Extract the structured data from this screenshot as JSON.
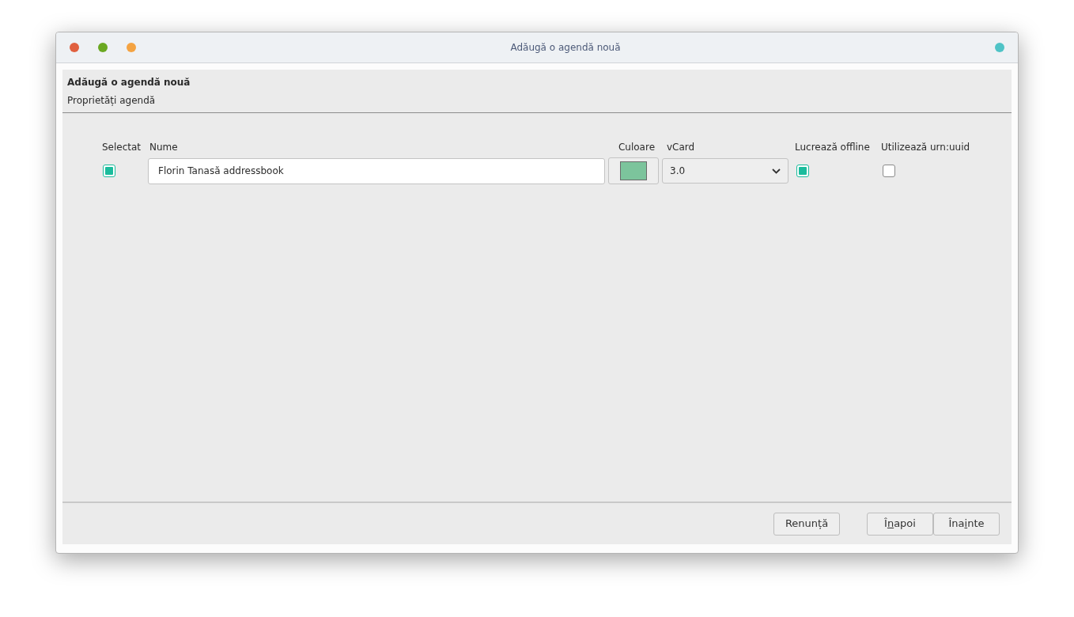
{
  "window": {
    "title": "Adăugă o agendă nouă"
  },
  "header": {
    "title": "Adăugă o agendă nouă",
    "subtitle": "Proprietăți agendă"
  },
  "columns": [
    "Selectat",
    "Nume",
    "Culoare",
    "vCard",
    "Lucrează offline",
    "Utilizează urn:uuid"
  ],
  "row": {
    "selected": true,
    "name": "Florin Tanasă addressbook",
    "color": "#7cc49c",
    "vcard": "3.0",
    "offline": true,
    "urn_uuid": false
  },
  "buttons": [
    {
      "kind": "cancel",
      "before": "Renunță"
    },
    {
      "kind": "back",
      "before": "Î",
      "key": "n",
      "after": "apoi"
    },
    {
      "kind": "next",
      "before": "Îna",
      "key": "i",
      "after": "nte"
    }
  ]
}
